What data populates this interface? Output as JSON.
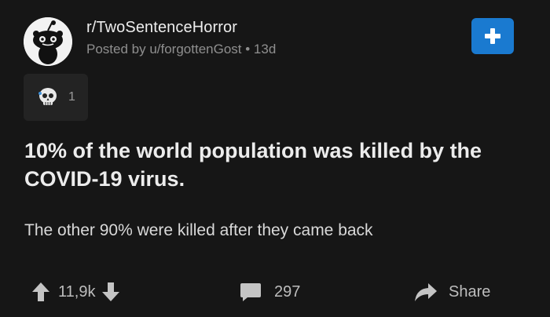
{
  "subreddit": {
    "name": "r/TwoSentenceHorror",
    "avatar_icon": "snoo-icon",
    "join_icon": "plus-icon"
  },
  "post": {
    "meta": "Posted by u/forgottenGost • 13d",
    "award_icon": "skull-award-icon",
    "award_count": "1",
    "title": "10% of the world population was killed by the COVID-19 virus.",
    "body": "The other 90% were killed after they came back"
  },
  "actions": {
    "vote_count": "11,9k",
    "comment_count": "297",
    "share_label": "Share"
  },
  "colors": {
    "background": "#161616",
    "accent": "#1a7ad0",
    "chip": "#232323"
  }
}
